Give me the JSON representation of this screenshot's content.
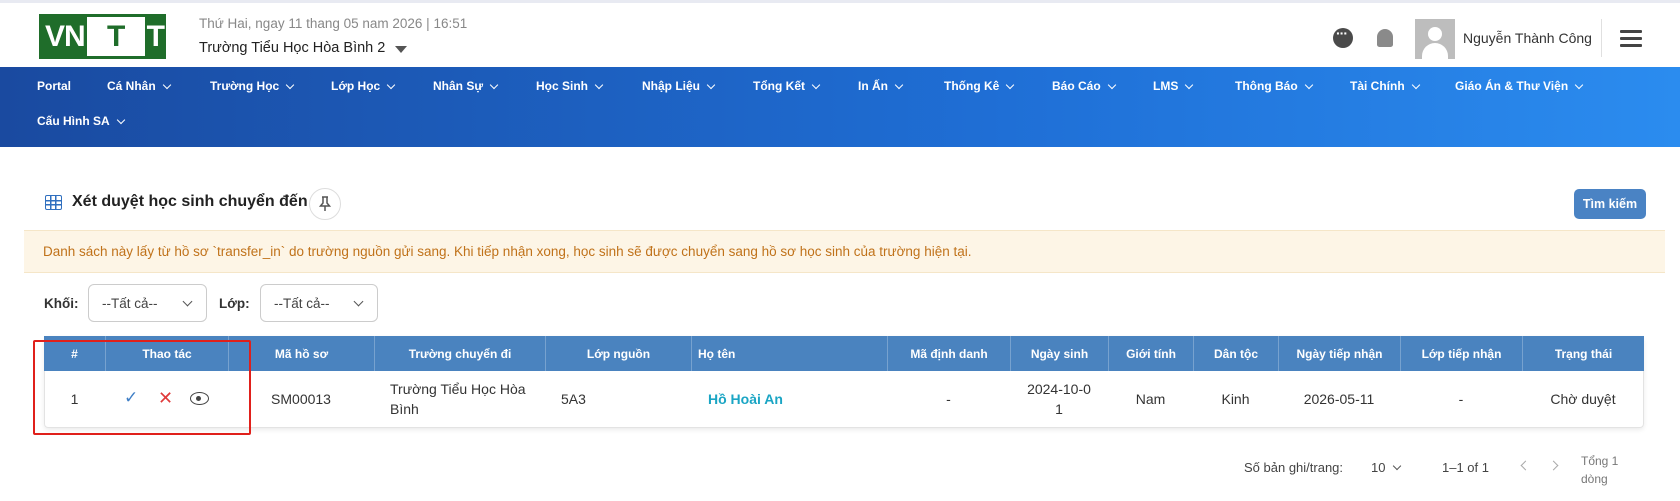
{
  "header": {
    "logo_left": "VN",
    "logo_right": "T",
    "date_line": "Thứ Hai, ngay 11 thang 05 nam 2026 | 16:51",
    "school": "Trường Tiểu Học Hòa Bình 2",
    "user_name": "Nguyễn Thành Công"
  },
  "nav": {
    "row1": [
      "Portal",
      "Cá Nhân",
      "Trường Học",
      "Lớp Học",
      "Nhân Sự",
      "Học Sinh",
      "Nhập Liệu",
      "Tổng Kết",
      "In Ấn",
      "Thống Kê",
      "Báo Cáo",
      "LMS",
      "Thông Báo",
      "Tài Chính",
      "Giáo Án & Thư Viện"
    ],
    "row2": [
      "Cấu Hình SA"
    ]
  },
  "page": {
    "title": "Xét duyệt học sinh chuyển đến",
    "search_button": "Tìm kiếm",
    "notice": "Danh sách này lấy từ hồ sơ `transfer_in` do trường nguồn gửi sang. Khi tiếp nhận xong, học sinh sẽ được chuyển sang hồ sơ học sinh của trường hiện tại.",
    "filters": {
      "grade_label": "Khối:",
      "grade_value": "--Tất cả--",
      "class_label": "Lớp:",
      "class_value": "--Tất cả--"
    }
  },
  "table": {
    "columns": [
      "#",
      "Thao tác",
      "Mã hồ sơ",
      "Trường chuyển đi",
      "Lớp nguồn",
      "Họ tên",
      "Mã định danh",
      "Ngày sinh",
      "Giới tính",
      "Dân tộc",
      "Ngày tiếp nhận",
      "Lớp tiếp nhận",
      "Trạng thái"
    ],
    "rows": [
      {
        "index": "1",
        "ma_ho_so": "SM00013",
        "truong_chuyen_di": "Trường Tiểu Học Hòa Bình",
        "lop_nguon": "5A3",
        "ho_ten": "Hồ Hoài An",
        "ma_dinh_danh": "-",
        "ngay_sinh": "2024-10-01",
        "gioi_tinh": "Nam",
        "dan_toc": "Kinh",
        "ngay_tiep_nhan": "2026-05-11",
        "lop_tiep_nhan": "-",
        "trang_thai": "Chờ duyệt"
      }
    ]
  },
  "pagination": {
    "rows_per_page_label": "Số bản ghi/trang:",
    "rows_per_page": "10",
    "range": "1–1 of 1",
    "total": "Tổng 1 dòng"
  },
  "icons": {
    "approve": "check-icon",
    "reject": "close-icon",
    "view": "eye-icon",
    "pin": "pin-icon",
    "chat": "chat-icon",
    "bell": "bell-icon",
    "menu": "hamburger-icon"
  },
  "colors": {
    "nav_start": "#1a4aa0",
    "nav_end": "#2b8cef",
    "table_header": "#4a83bf",
    "notice_bg": "#fdf5e6",
    "notice_text": "#c0721a",
    "link": "#1aa5c4",
    "highlight": "#e0201b"
  }
}
